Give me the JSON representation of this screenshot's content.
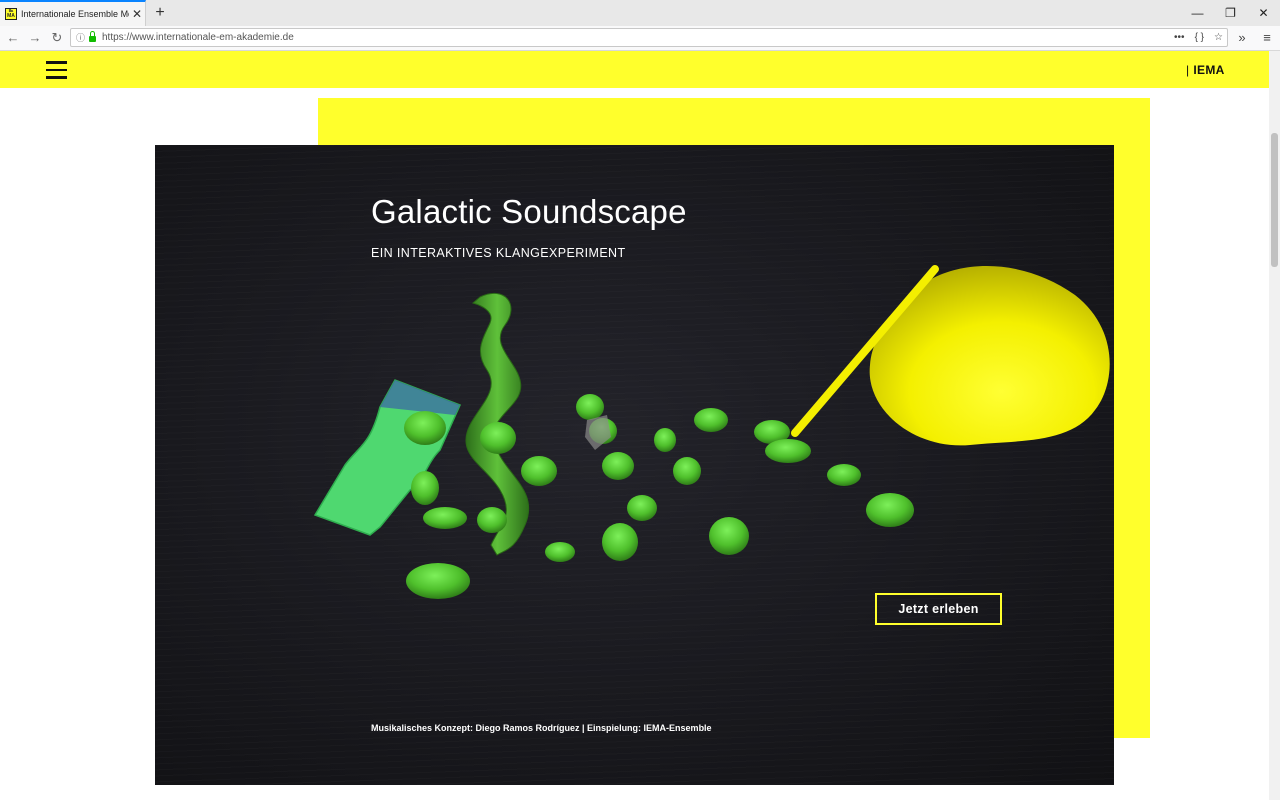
{
  "browser": {
    "tab_title": "Internationale Ensemble Mode",
    "tab_close": "✕",
    "new_tab": "+",
    "favicon_text": "IE MA",
    "url": "https://www.internationale-em-akademie.de",
    "url_actions": [
      "•••",
      "{ }",
      "☆"
    ],
    "overflow": "»",
    "menu": "≡",
    "window_controls": [
      "—",
      "❐",
      "✕"
    ],
    "nav": {
      "back": "←",
      "forward": "→",
      "reload": "↻"
    }
  },
  "site": {
    "brand": "IEMA",
    "brand_separator": "|"
  },
  "hero": {
    "title": "Galactic Soundscape",
    "subtitle": "EIN INTERAKTIVES KLANGEXPERIMENT",
    "cta_label": "Jetzt erleben",
    "credits": "Musikalisches Konzept: Diego Ramos Rodríguez | Einspielung: IEMA-Ensemble"
  },
  "colors": {
    "accent_yellow": "#ffff2c",
    "hero_dark": "#19191e",
    "shape_green": "#5fd63a"
  }
}
